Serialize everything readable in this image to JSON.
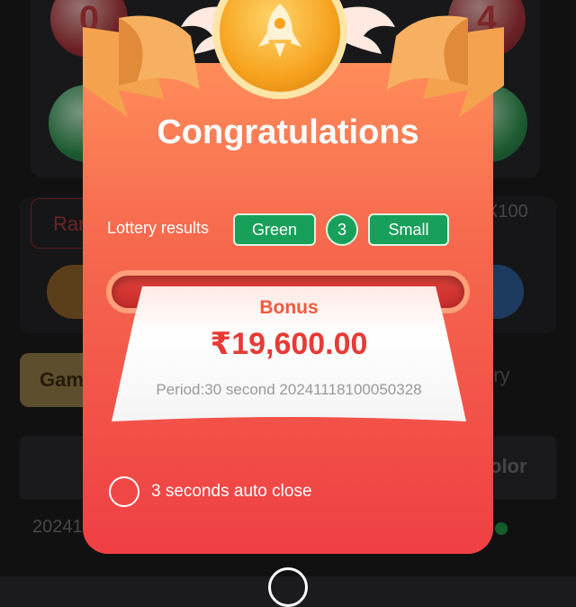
{
  "background": {
    "balls": [
      "0",
      "4",
      "",
      ""
    ],
    "random_button": "Ran",
    "multiplier": "X100",
    "tab_game": "Gam",
    "tab_history": "ory",
    "column_color": "olor",
    "row_period": "20241"
  },
  "modal": {
    "title": "Congratulations",
    "results_label": "Lottery results",
    "result_color": "Green",
    "result_number": "3",
    "result_size": "Small",
    "bonus_label": "Bonus",
    "bonus_amount": "₹19,600.00",
    "period_text": "Period:30 second 20241118100050328",
    "auto_close": "3 seconds auto close",
    "icons": [
      "rocket-icon",
      "radio-circle-icon",
      "close-icon"
    ]
  },
  "colors": {
    "card_top": "#ff8c5a",
    "card_bottom": "#ef3f44",
    "pill_green": "#18a05a",
    "bonus_red": "#e83a35"
  }
}
